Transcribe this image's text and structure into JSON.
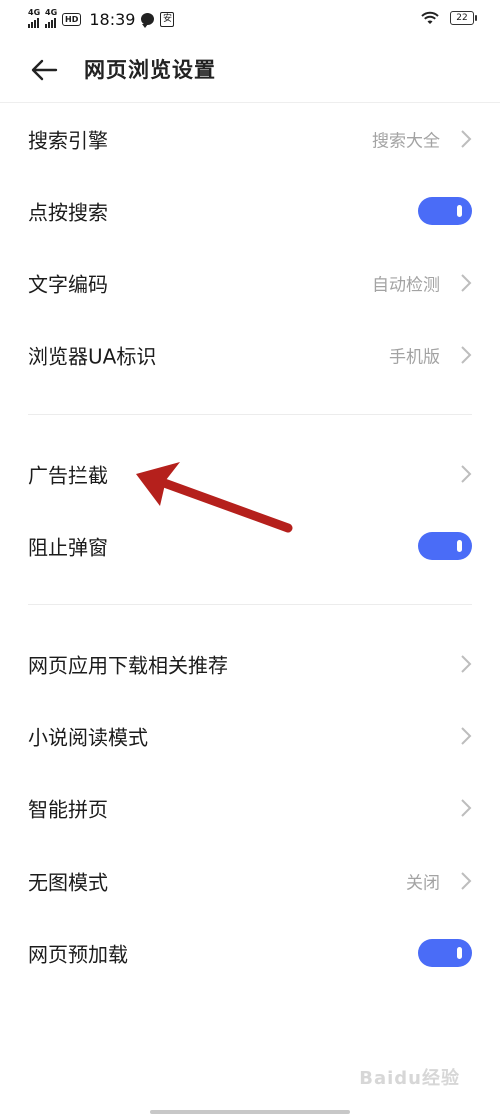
{
  "status_bar": {
    "net1": "4G",
    "net2": "4G",
    "hd": "HD",
    "time": "18:39",
    "app_icon_glyph": "安",
    "battery": "22"
  },
  "header": {
    "title": "网页浏览设置"
  },
  "settings": {
    "search_engine": {
      "label": "搜索引擎",
      "value": "搜索大全"
    },
    "tap_search": {
      "label": "点按搜索",
      "enabled": true
    },
    "text_encoding": {
      "label": "文字编码",
      "value": "自动检测"
    },
    "browser_ua": {
      "label": "浏览器UA标识",
      "value": "手机版"
    },
    "ad_block": {
      "label": "广告拦截"
    },
    "block_popups": {
      "label": "阻止弹窗",
      "enabled": true
    },
    "web_app_recommend": {
      "label": "网页应用下载相关推荐"
    },
    "novel_mode": {
      "label": "小说阅读模式"
    },
    "smart_page_join": {
      "label": "智能拼页"
    },
    "no_image_mode": {
      "label": "无图模式",
      "value": "关闭"
    },
    "preload": {
      "label": "网页预加载",
      "enabled": true
    }
  },
  "watermark": "Baidu经验",
  "colors": {
    "toggle_on": "#4a6cf7",
    "annotation_arrow": "#b5201c",
    "value_text": "#a3a3a3"
  },
  "icons": [
    "back-arrow-icon",
    "chevron-right-icon",
    "wifi-icon",
    "battery-icon",
    "signal-icon"
  ]
}
